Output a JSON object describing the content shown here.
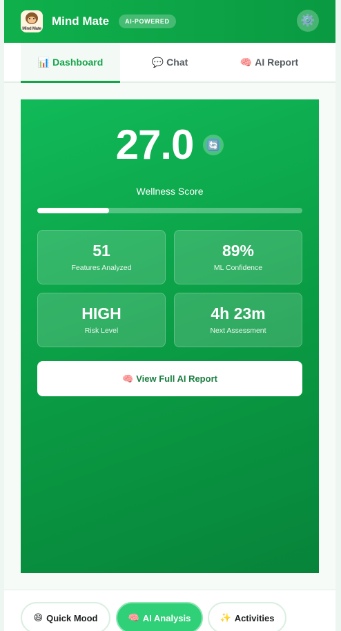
{
  "header": {
    "logo_text": "Mind Mate",
    "app_title": "Mind Mate",
    "badge": "AI-POWERED",
    "settings_icon": "⚙️"
  },
  "tabs": [
    {
      "icon": "📊",
      "label": "Dashboard",
      "active": true
    },
    {
      "icon": "💬",
      "label": "Chat",
      "active": false
    },
    {
      "icon": "🧠",
      "label": "AI Report",
      "active": false
    }
  ],
  "wellness": {
    "score": "27.0",
    "refresh_icon": "🔄",
    "label": "Wellness Score",
    "progress_fraction": 0.27
  },
  "stats": [
    {
      "value": "51",
      "label": "Features Analyzed"
    },
    {
      "value": "89%",
      "label": "ML Confidence"
    },
    {
      "value": "HIGH",
      "label": "Risk Level"
    },
    {
      "value": "4h 23m",
      "label": "Next Assessment"
    }
  ],
  "report_button": {
    "icon": "🧠",
    "label": "View Full AI Report"
  },
  "bottom_nav": [
    {
      "icon": "😄",
      "label": "Quick Mood",
      "active": false
    },
    {
      "icon": "🧠",
      "label": "AI Analysis",
      "active": true
    },
    {
      "icon": "✨",
      "label": "Activities",
      "active": false
    }
  ],
  "colors": {
    "brand_green": "#0fb04c",
    "active_tab_text": "#15a34a",
    "active_pill": "#2fd078"
  }
}
